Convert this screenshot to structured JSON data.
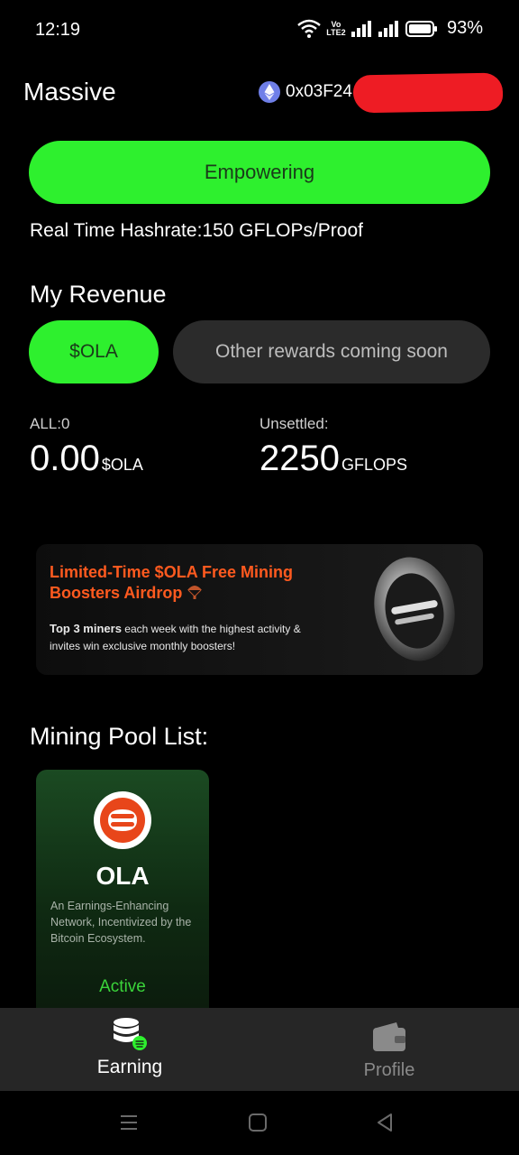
{
  "status_bar": {
    "time": "12:19",
    "network_label": "Vo LTE2",
    "battery": "93%"
  },
  "header": {
    "title": "Massive",
    "wallet_icon": "ethereum-icon",
    "wallet_address": "0x03F24"
  },
  "empower": {
    "button_label": "Empowering",
    "hashrate_text": "Real Time Hashrate:150 GFLOPs/Proof"
  },
  "revenue": {
    "title": "My Revenue",
    "tabs": [
      {
        "label": "$OLA",
        "selected": true
      },
      {
        "label": "Other rewards coming soon",
        "selected": false
      }
    ],
    "all_label": "ALL:0",
    "all_value": "0.00",
    "all_unit": "$OLA",
    "unsettled_label": "Unsettled:",
    "unsettled_value": "2250",
    "unsettled_unit": "GFLOPS"
  },
  "banner": {
    "headline": "Limited-Time $OLA Free Mining Boosters Airdrop",
    "body_bold": "Top 3 miners",
    "body_rest": " each week with the highest activity & invites win exclusive monthly boosters!"
  },
  "pools": {
    "title": "Mining Pool List:",
    "items": [
      {
        "name": "OLA",
        "description": "An Earnings-Enhancing Network, Incentivized by the Bitcoin Ecosystem.",
        "status": "Active"
      }
    ]
  },
  "bottom_nav": {
    "items": [
      {
        "label": "Earning",
        "icon": "database-coin-icon",
        "active": true
      },
      {
        "label": "Profile",
        "icon": "wallet-icon",
        "active": false
      }
    ]
  },
  "colors": {
    "accent_green": "#2ef02e",
    "banner_orange": "#ff5a1f",
    "active_green": "#3ad43a",
    "logo_orange": "#e8461a"
  }
}
